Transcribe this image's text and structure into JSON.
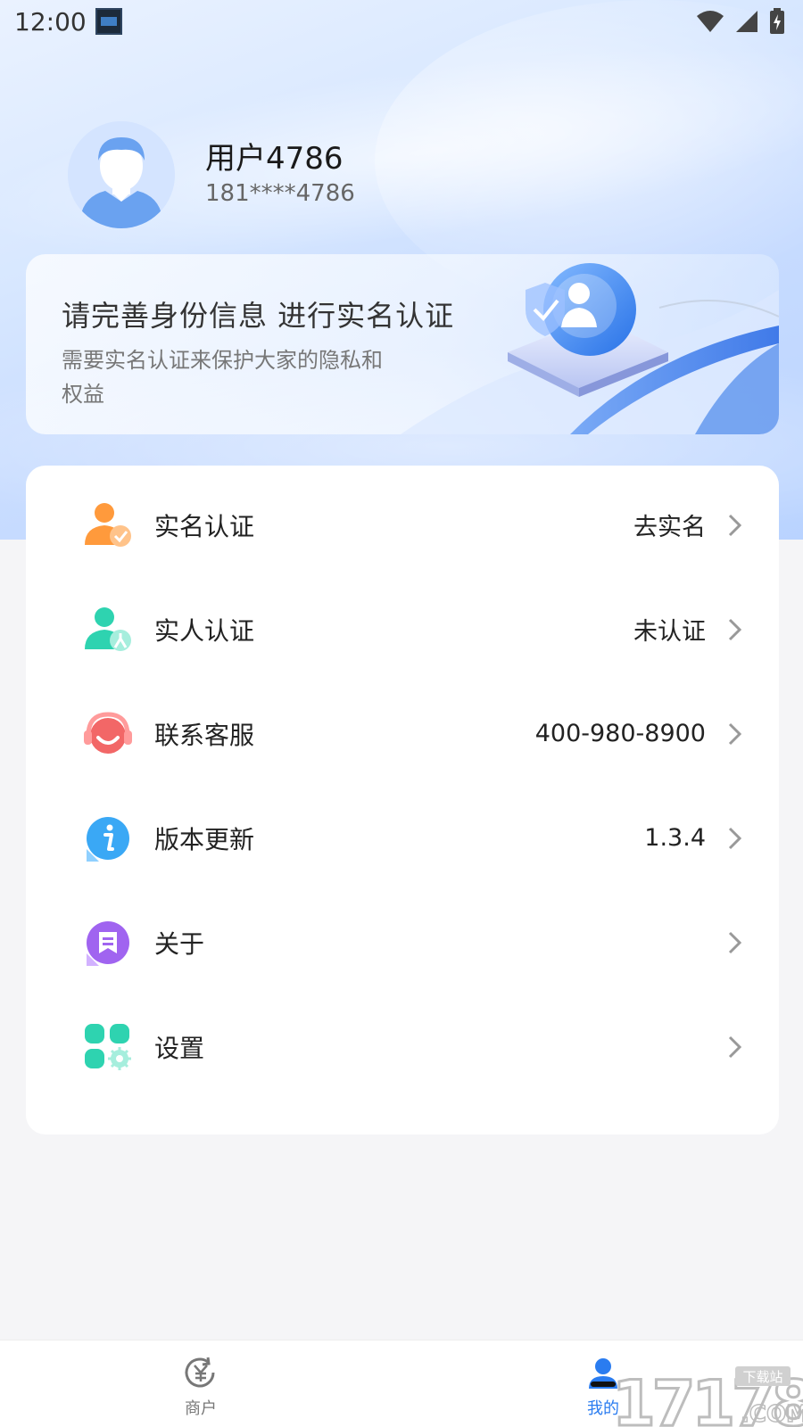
{
  "status_bar": {
    "time": "12:00",
    "icons": [
      "notification-thumbnail",
      "wifi-icon",
      "signal-icon",
      "battery-charging-icon"
    ]
  },
  "profile": {
    "name": "用户4786",
    "phone": "181****4786",
    "avatar": "default-avatar"
  },
  "banner": {
    "title": "请完善身份信息 进行实名认证",
    "description": "需要实名认证来保护大家的隐私和权益",
    "illustration": "shield-id-card-illustration"
  },
  "menu": {
    "items": [
      {
        "label": "实名认证",
        "value": "去实名",
        "icon": "real-name-verify-icon"
      },
      {
        "label": "实人认证",
        "value": "未认证",
        "icon": "face-verify-icon"
      },
      {
        "label": "联系客服",
        "value": "400-980-8900",
        "icon": "customer-service-icon"
      },
      {
        "label": "版本更新",
        "value": "1.3.4",
        "icon": "info-icon"
      },
      {
        "label": "关于",
        "value": "",
        "icon": "about-icon"
      },
      {
        "label": "设置",
        "value": "",
        "icon": "settings-icon"
      }
    ]
  },
  "bottom_nav": {
    "items": [
      {
        "label": "商户",
        "icon": "merchant-yuan-icon",
        "active": false
      },
      {
        "label": "我的",
        "icon": "mine-user-icon",
        "active": true
      }
    ]
  },
  "watermark": {
    "text": "17178",
    "badge": "下载站",
    "suffix": ".COM"
  },
  "colors": {
    "accent": "#2a7cf0",
    "orange": "#ff9a3c",
    "teal": "#2ed3b0",
    "red": "#f26767",
    "blue": "#3aa8f5",
    "purple": "#a064f0"
  }
}
